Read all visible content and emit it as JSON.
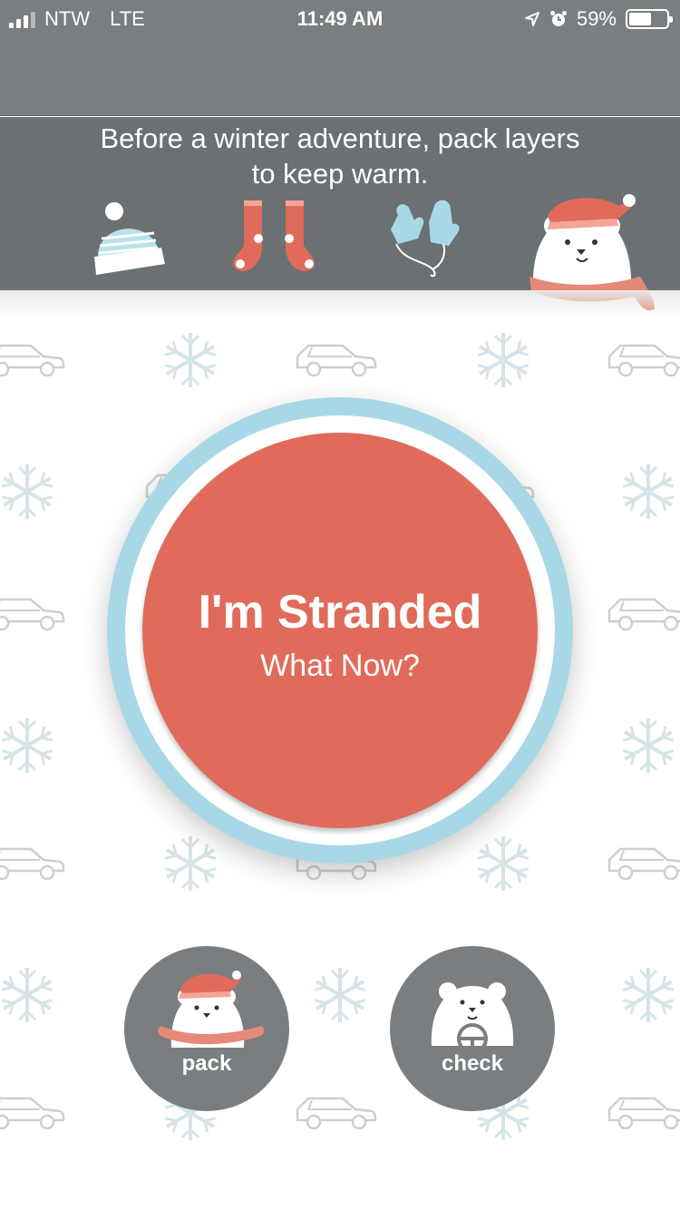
{
  "status_bar": {
    "carrier": "NTW",
    "network": "LTE",
    "time": "11:49 AM",
    "battery": "59%",
    "battery_level": 0.59
  },
  "banner": {
    "line1": "Before a winter adventure, pack layers",
    "line2": "to keep warm.",
    "icons": [
      "hat-icon",
      "socks-icon",
      "mittens-icon",
      "polar-bear-scarf-icon"
    ]
  },
  "main_button": {
    "title": "I'm Stranded",
    "subtitle": "What Now?"
  },
  "pack_button": {
    "label": "pack",
    "icon": "polar-bear-scarf-icon"
  },
  "check_button": {
    "label": "check",
    "icon": "polar-bear-steering-wheel-icon"
  },
  "colors": {
    "header": "#7a7e80",
    "banner": "#6b7073",
    "accent": "#e06b5a",
    "ring": "#a8d8e6"
  }
}
